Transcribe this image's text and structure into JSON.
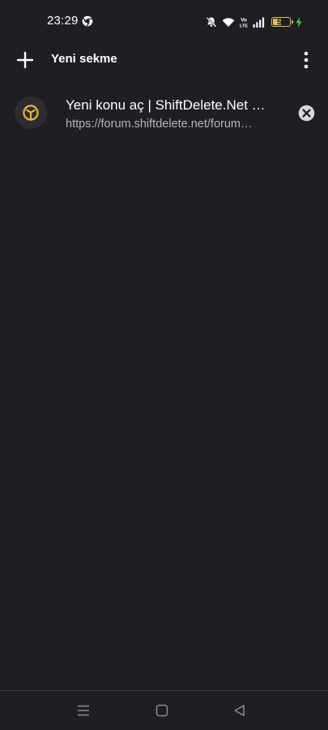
{
  "status_bar": {
    "time": "23:29",
    "app_icon": "chrome-icon",
    "icons": [
      "mute-icon",
      "wifi-icon",
      "volte-icon",
      "signal-icon",
      "battery-icon",
      "charging-icon"
    ],
    "volte_label": "Vo LTE",
    "battery_level": "54",
    "battery_fraction": 0.54,
    "battery_color": "#d9c05a",
    "charging_color": "#3ccf4e"
  },
  "app_bar": {
    "new_tab_icon": "plus-icon",
    "title": "Yeni sekme",
    "more_icon": "more-vertical-icon"
  },
  "tabs": [
    {
      "title": "Yeni konu aç | ShiftDelete.Net …",
      "url": "https://forum.shiftdelete.net/forum…",
      "favicon": "shiftdelete-logo-icon",
      "close_icon": "close-circle-icon"
    }
  ],
  "nav_bar": {
    "buttons": [
      "menu-icon",
      "home-icon",
      "back-icon"
    ]
  },
  "colors": {
    "background": "#1f1e23",
    "text_primary": "#ffffff",
    "text_secondary": "#b5b4ba",
    "favicon_bg": "#2d2c32",
    "favicon_accent": "#e6b53a"
  }
}
